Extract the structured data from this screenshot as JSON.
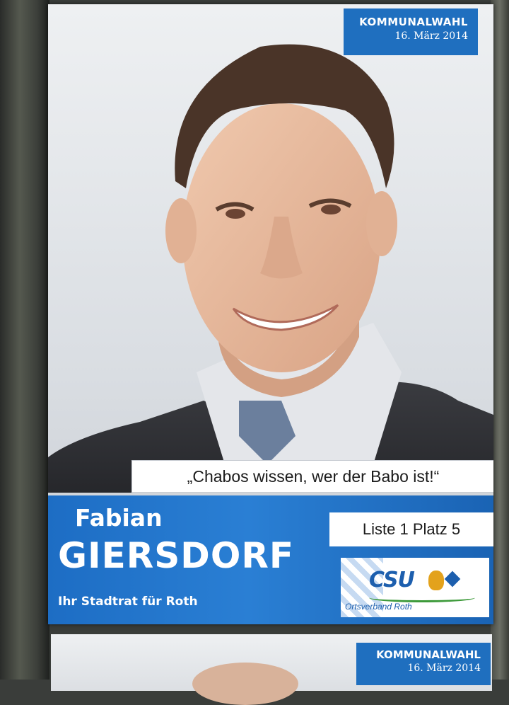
{
  "poster": {
    "badge_title": "KOMMUNALWAHL",
    "badge_date": "16. März 2014",
    "quote": "„Chabos wissen, wer der Babo ist!“",
    "first_name": "Fabian",
    "last_name": "GIERSDORF",
    "subtitle": "Ihr Stadtrat für Roth",
    "list_position": "Liste 1 Platz 5",
    "party_logo_text": "CSU",
    "party_branch": "Ortsverband Roth"
  },
  "next_poster": {
    "badge_title": "KOMMUNALWAHL",
    "badge_date": "16. März 2014"
  },
  "colors": {
    "brand_blue": "#1f6fbf",
    "csu_blue": "#1d5fae",
    "csu_green": "#3d9a3a",
    "lion_gold": "#e3a21c"
  }
}
